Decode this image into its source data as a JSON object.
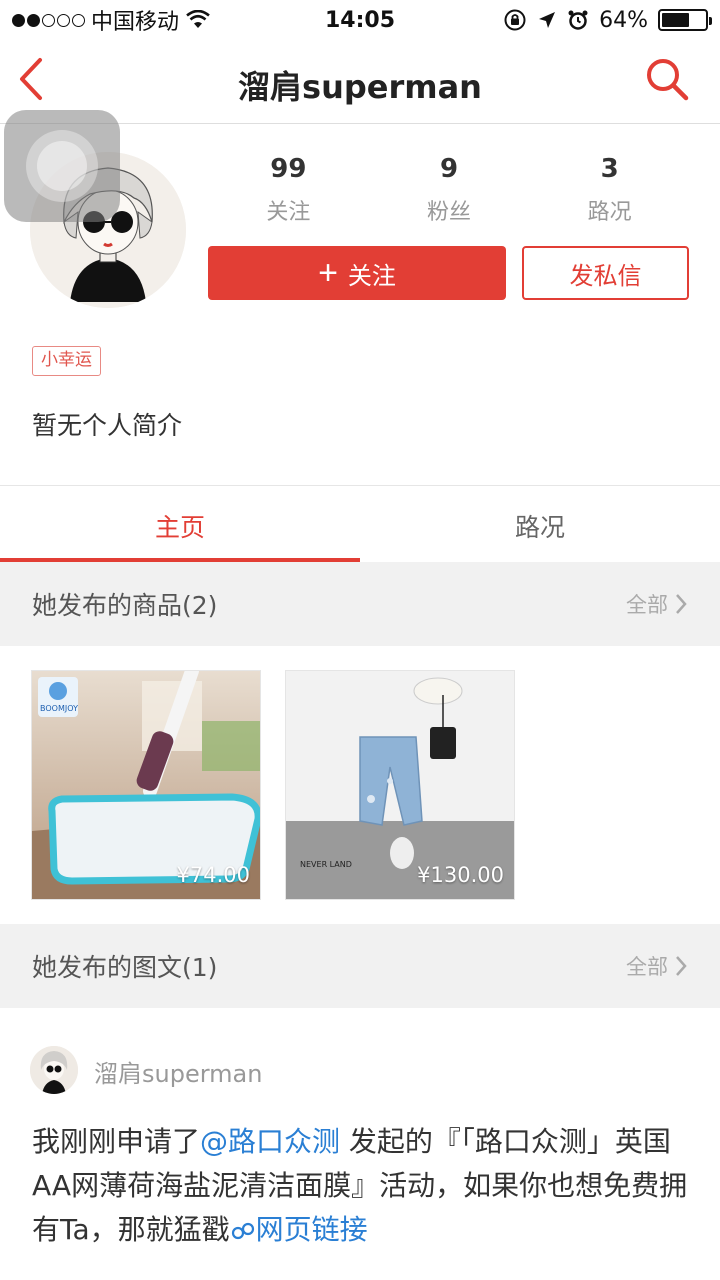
{
  "status_bar": {
    "carrier": "中国移动",
    "time": "14:05",
    "battery": "64%",
    "battery_level": 0.64
  },
  "nav": {
    "title": "溜肩superman",
    "back_icon": "chevron-left-icon",
    "search_icon": "search-icon"
  },
  "profile": {
    "stats": [
      {
        "value": "99",
        "label": "关注"
      },
      {
        "value": "9",
        "label": "粉丝"
      },
      {
        "value": "3",
        "label": "路况"
      }
    ],
    "follow_label": "关注",
    "message_label": "发私信",
    "tag": "小幸运",
    "bio": "暂无个人简介"
  },
  "tabs": [
    {
      "label": "主页",
      "active": true
    },
    {
      "label": "路况",
      "active": false
    }
  ],
  "products_section": {
    "title": "她发布的商品(2)",
    "more": "全部",
    "items": [
      {
        "price": "¥74.00",
        "brand": "BOOMJOY"
      },
      {
        "price": "¥130.00",
        "brand": "NEVER LAND"
      }
    ]
  },
  "posts_section": {
    "title": "她发布的图文(1)",
    "more": "全部"
  },
  "post": {
    "author": "溜肩superman",
    "text_prefix": "我刚刚申请了",
    "mention": "@路口众测",
    "text_middle": " 发起的『「路口众测」英国AA网薄荷海盐泥清洁面膜』活动，如果你也想免费拥有Ta，那就猛戳",
    "link_label": "网页链接"
  },
  "colors": {
    "accent": "#e23e35",
    "link": "#2a7fd4",
    "section_bg": "#f1f1f1"
  }
}
